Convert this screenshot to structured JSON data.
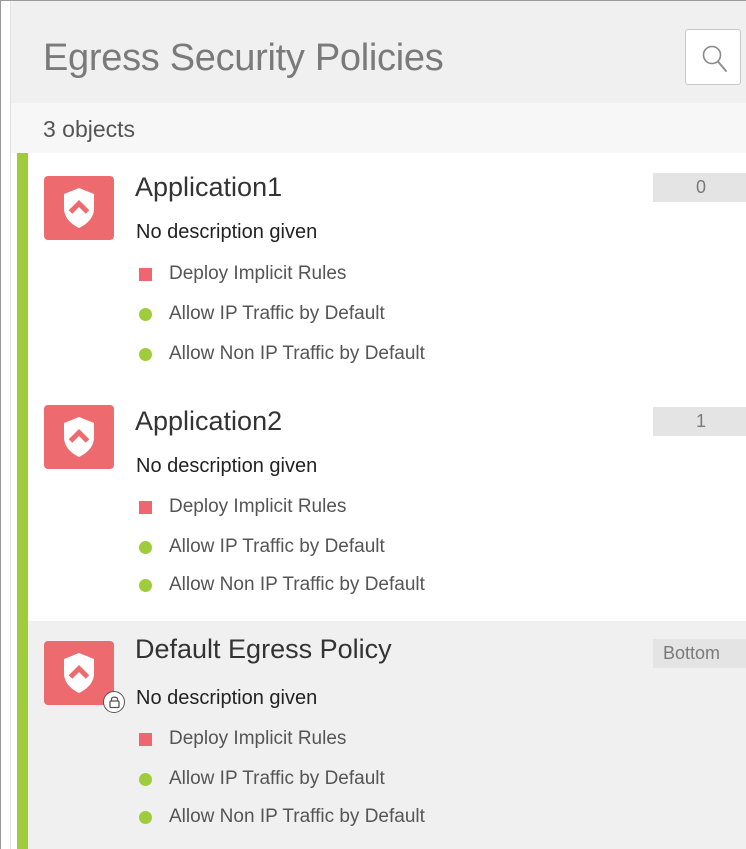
{
  "header": {
    "title": "Egress Security Policies",
    "search_icon": "search-icon"
  },
  "list_info": {
    "count_label": "3 objects"
  },
  "colors": {
    "accent_bar": "#9fcc3a",
    "policy_icon_bg": "#ed6a6f",
    "deny_marker": "#ef6570",
    "allow_marker": "#9fcc3a"
  },
  "policies": [
    {
      "name": "Application1",
      "description": "No description given",
      "order": "0",
      "icon": "shield-icon",
      "locked": false,
      "selected": false,
      "properties": [
        {
          "label": "Deploy Implicit Rules",
          "state": "off",
          "marker": "square"
        },
        {
          "label": "Allow IP Traffic by Default",
          "state": "on",
          "marker": "dot"
        },
        {
          "label": "Allow Non IP Traffic by Default",
          "state": "on",
          "marker": "dot"
        }
      ]
    },
    {
      "name": "Application2",
      "description": "No description given",
      "order": "1",
      "icon": "shield-icon",
      "locked": false,
      "selected": false,
      "properties": [
        {
          "label": "Deploy Implicit Rules",
          "state": "off",
          "marker": "square"
        },
        {
          "label": "Allow IP Traffic by Default",
          "state": "on",
          "marker": "dot"
        },
        {
          "label": "Allow Non IP Traffic by Default",
          "state": "on",
          "marker": "dot"
        }
      ]
    },
    {
      "name": "Default Egress Policy",
      "description": "No description given",
      "order": "Bottom",
      "icon": "shield-icon",
      "locked": true,
      "selected": true,
      "properties": [
        {
          "label": "Deploy Implicit Rules",
          "state": "off",
          "marker": "square"
        },
        {
          "label": "Allow IP Traffic by Default",
          "state": "on",
          "marker": "dot"
        },
        {
          "label": "Allow Non IP Traffic by Default",
          "state": "on",
          "marker": "dot"
        }
      ]
    }
  ]
}
